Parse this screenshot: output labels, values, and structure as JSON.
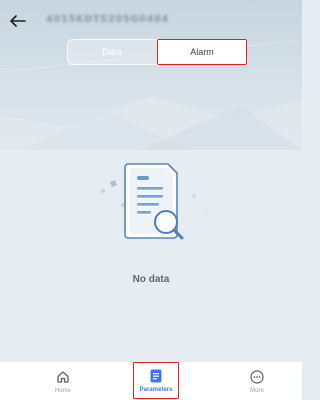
{
  "header": {
    "back_icon": "arrow-left-icon",
    "device_id": "4015KDTS205G0484"
  },
  "tabs": [
    {
      "label": "Data",
      "active": false
    },
    {
      "label": "Alarm",
      "active": true
    }
  ],
  "empty_state": {
    "illustration": "document-search-icon",
    "message": "No data"
  },
  "bottom_nav": [
    {
      "label": "Home",
      "icon": "home-icon",
      "active": false
    },
    {
      "label": "Parameters",
      "icon": "document-list-icon",
      "active": true
    },
    {
      "label": "More",
      "icon": "more-circle-icon",
      "active": false
    }
  ],
  "colors": {
    "accent": "#3b78e7",
    "highlight_border": "#e02424",
    "page_bg": "#e6edf2"
  }
}
